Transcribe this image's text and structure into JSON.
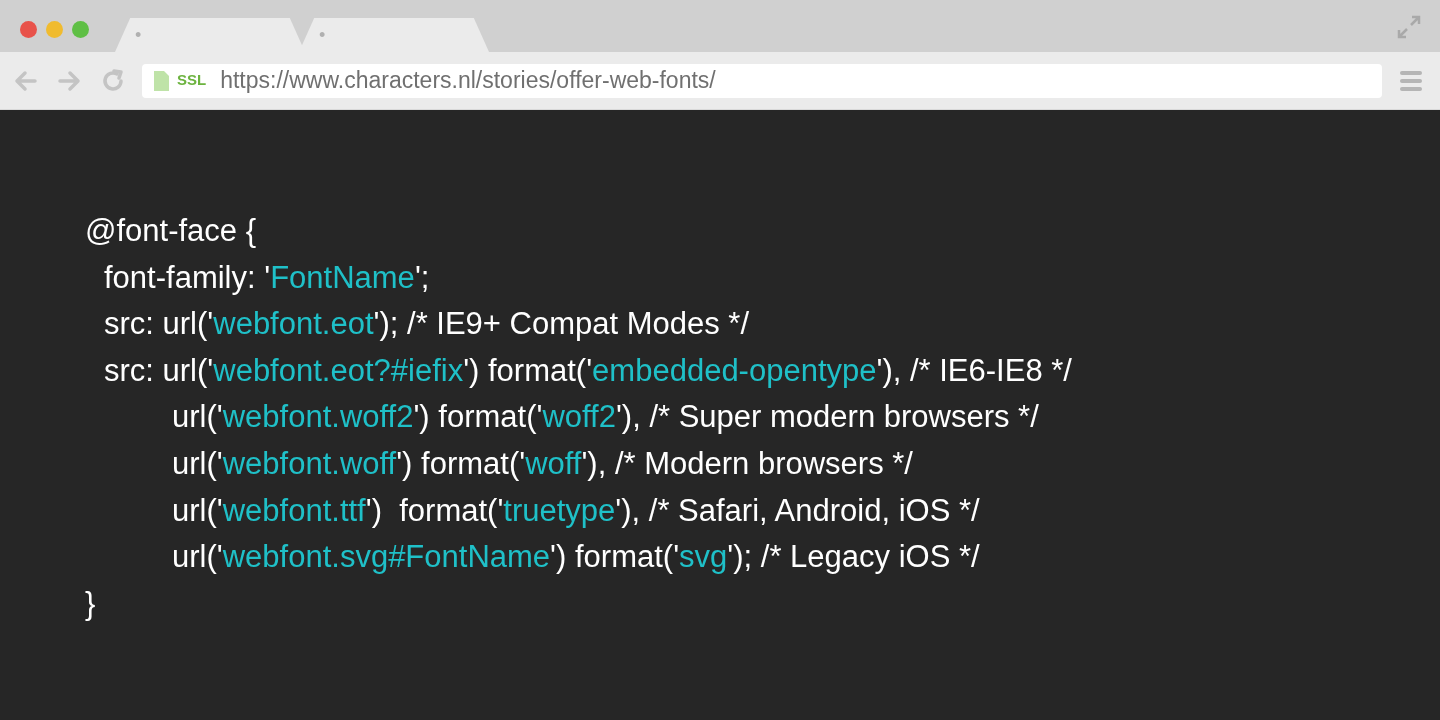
{
  "browser": {
    "tabs": [
      {
        "label": "•"
      },
      {
        "label": "•"
      }
    ],
    "address_bar": {
      "badge": "SSL",
      "url": "https://www.characters.nl/stories/offer-web-fonts/"
    }
  },
  "code": [
    {
      "segments": [
        {
          "kind": "plain",
          "text": "@font-face {"
        }
      ],
      "children": [
        {
          "segments": [
            {
              "kind": "plain",
              "text": "font-family: '"
            },
            {
              "kind": "string",
              "text": "FontName"
            },
            {
              "kind": "plain",
              "text": "';"
            }
          ]
        },
        {
          "segments": [
            {
              "kind": "plain",
              "text": "src: url('"
            },
            {
              "kind": "string",
              "text": "webfont.eot"
            },
            {
              "kind": "plain",
              "text": "'); /* IE9+ Compat Modes */"
            }
          ]
        },
        {
          "segments": [
            {
              "kind": "plain",
              "text": "src: url('"
            },
            {
              "kind": "string",
              "text": "webfont.eot?#iefix"
            },
            {
              "kind": "plain",
              "text": "') format('"
            },
            {
              "kind": "string",
              "text": "embedded-opentype"
            },
            {
              "kind": "plain",
              "text": "'), /* IE6-IE8 */"
            }
          ],
          "children": [
            {
              "segments": [
                {
                  "kind": "plain",
                  "text": "url('"
                },
                {
                  "kind": "string",
                  "text": "webfont.woff2"
                },
                {
                  "kind": "plain",
                  "text": "') format('"
                },
                {
                  "kind": "string",
                  "text": "woff2"
                },
                {
                  "kind": "plain",
                  "text": "'), /* Super modern browsers */"
                }
              ]
            },
            {
              "segments": [
                {
                  "kind": "plain",
                  "text": "url('"
                },
                {
                  "kind": "string",
                  "text": "webfont.woff"
                },
                {
                  "kind": "plain",
                  "text": "') format('"
                },
                {
                  "kind": "string",
                  "text": "woff"
                },
                {
                  "kind": "plain",
                  "text": "'), /* Modern browsers */"
                }
              ]
            },
            {
              "segments": [
                {
                  "kind": "plain",
                  "text": "url('"
                },
                {
                  "kind": "string",
                  "text": "webfont.ttf"
                },
                {
                  "kind": "plain",
                  "text": "')  format('"
                },
                {
                  "kind": "string",
                  "text": "truetype"
                },
                {
                  "kind": "plain",
                  "text": "'), /* Safari, Android, iOS */"
                }
              ]
            },
            {
              "segments": [
                {
                  "kind": "plain",
                  "text": "url('"
                },
                {
                  "kind": "string",
                  "text": "webfont.svg#FontName"
                },
                {
                  "kind": "plain",
                  "text": "') format('"
                },
                {
                  "kind": "string",
                  "text": "svg"
                },
                {
                  "kind": "plain",
                  "text": "'); /* Legacy iOS */"
                }
              ]
            }
          ]
        }
      ]
    },
    {
      "segments": [
        {
          "kind": "plain",
          "text": "}"
        }
      ]
    }
  ]
}
